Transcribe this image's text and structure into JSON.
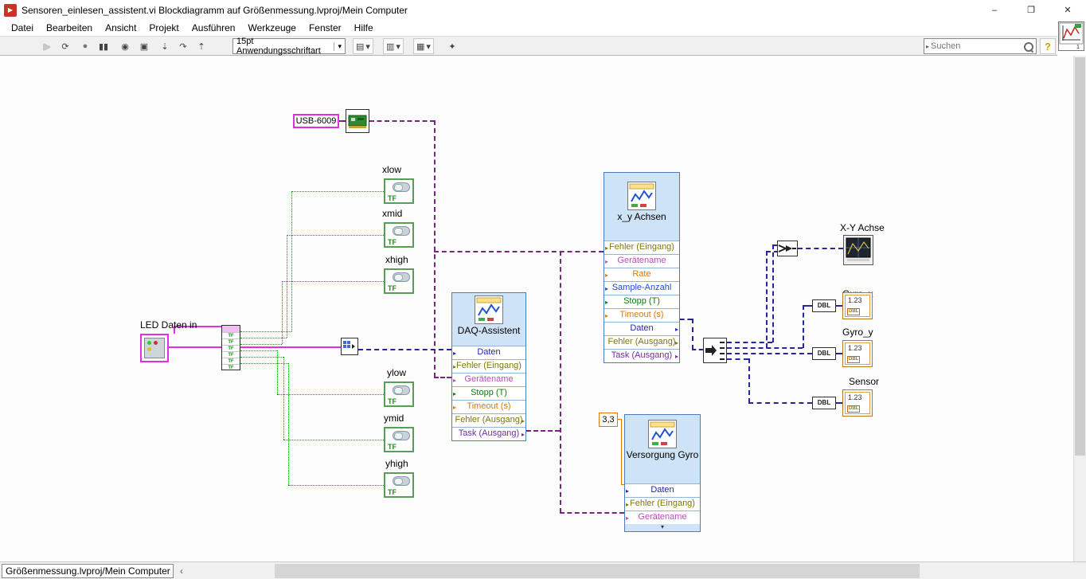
{
  "window": {
    "title": "Sensoren_einlesen_assistent.vi Blockdiagramm auf Größenmessung.lvproj/Mein Computer",
    "minimize": "–",
    "maximize": "❐",
    "close": "✕"
  },
  "menubar": {
    "items": [
      "Datei",
      "Bearbeiten",
      "Ansicht",
      "Projekt",
      "Ausführen",
      "Werkzeuge",
      "Fenster",
      "Hilfe"
    ]
  },
  "toolbar": {
    "font_selector": "15pt Anwendungsschriftart",
    "search_placeholder": "Suchen",
    "help_label": "?",
    "icons": {
      "run": "▶",
      "run_continuous": "⟳",
      "abort": "●",
      "pause": "▮▮",
      "highlight_execution": "◉",
      "retain_wire_values": "▣",
      "step_into": "⇣",
      "step_over": "↷",
      "step_out": "⇡",
      "align_objects": "▤",
      "distribute_objects": "▥",
      "resize_objects": "▦",
      "cleanup_diagram": "✦",
      "dropdown": "▾"
    }
  },
  "diagram": {
    "constants": {
      "device_name": "USB-6009",
      "voltage": "3,3"
    },
    "cluster_control_label": "LED Daten in",
    "bool_controls": [
      {
        "label": "xlow"
      },
      {
        "label": "xmid"
      },
      {
        "label": "xhigh"
      },
      {
        "label": "ylow"
      },
      {
        "label": "ymid"
      },
      {
        "label": "yhigh"
      }
    ],
    "glyphs": {
      "tf": "TF",
      "dbl": "DBL",
      "numeric_preview": "1.23",
      "expand_chevron": "▾"
    },
    "express_vis": {
      "daq": {
        "title": "DAQ-Assistent",
        "terminals": [
          {
            "label": "Daten",
            "color": "#2626aa",
            "dir": "in"
          },
          {
            "label": "Fehler (Eingang)",
            "color": "#7d7a00",
            "dir": "in"
          },
          {
            "label": "Gerätename",
            "color": "#b84fb8",
            "dir": "in"
          },
          {
            "label": "Stopp (T)",
            "color": "#0f7d0f",
            "dir": "in"
          },
          {
            "label": "Timeout (s)",
            "color": "#e07800",
            "dir": "in"
          },
          {
            "label": "Fehler (Ausgang)",
            "color": "#7d7a00",
            "dir": "out"
          },
          {
            "label": "Task (Ausgang)",
            "color": "#6f2da8",
            "dir": "out"
          }
        ]
      },
      "xy": {
        "title": "x_y Achsen",
        "terminals": [
          {
            "label": "Fehler (Eingang)",
            "color": "#7d7a00",
            "dir": "in"
          },
          {
            "label": "Gerätename",
            "color": "#b84fb8",
            "dir": "in"
          },
          {
            "label": "Rate",
            "color": "#e07800",
            "dir": "in"
          },
          {
            "label": "Sample-Anzahl",
            "color": "#2745e0",
            "dir": "in"
          },
          {
            "label": "Stopp (T)",
            "color": "#0f7d0f",
            "dir": "in"
          },
          {
            "label": "Timeout (s)",
            "color": "#e07800",
            "dir": "in"
          },
          {
            "label": "Daten",
            "color": "#2626aa",
            "dir": "out"
          },
          {
            "label": "Fehler (Ausgang)",
            "color": "#7d7a00",
            "dir": "out"
          },
          {
            "label": "Task (Ausgang)",
            "color": "#6f2da8",
            "dir": "out"
          }
        ]
      },
      "gyro": {
        "title": "Versorgung Gyro",
        "terminals": [
          {
            "label": "Daten",
            "color": "#2626aa",
            "dir": "in"
          },
          {
            "label": "Fehler (Eingang)",
            "color": "#7d7a00",
            "dir": "in"
          },
          {
            "label": "Gerätename",
            "color": "#b84fb8",
            "dir": "in"
          }
        ]
      }
    },
    "indicators": [
      {
        "label": "X-Y Achse",
        "type": "xy-graph"
      },
      {
        "label": "Gyro_x",
        "type": "numeric-dbl"
      },
      {
        "label": "Gyro_y",
        "type": "numeric-dbl"
      },
      {
        "label": "Sensor",
        "type": "numeric-dbl"
      }
    ],
    "wire_colors": {
      "boolean": "#00a000",
      "cluster": "#e12ee1",
      "dynamic_data": "#26269c",
      "daqmx_name_task": "#7a2482",
      "numeric": "#e07800"
    }
  },
  "statusbar": {
    "context": "Größenmessung.lvproj/Mein Computer",
    "scroll_left": "‹"
  }
}
